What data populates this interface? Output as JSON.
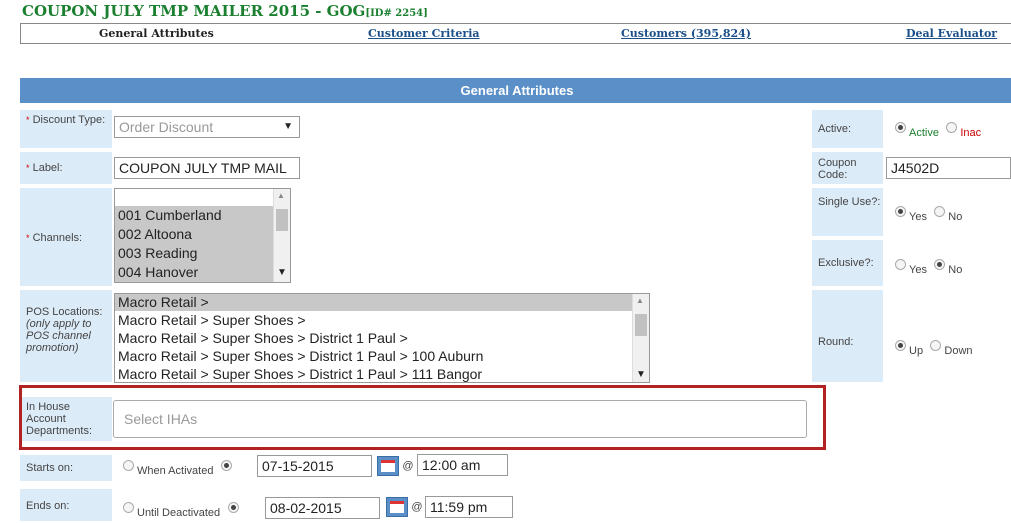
{
  "title": {
    "main": "COUPON JULY TMP MAILER 2015 - GOG",
    "id": "[ID# 2254]"
  },
  "tabs": [
    {
      "label": "General Attributes"
    },
    {
      "label": "Customer Criteria"
    },
    {
      "label": "Customers (395,824)"
    },
    {
      "label": "Deal Evaluator"
    }
  ],
  "panel": {
    "title": "General Attributes"
  },
  "discount_type": {
    "required_mark": "*",
    "label": "Discount Type:",
    "value": "Order Discount"
  },
  "label_field": {
    "required_mark": "*",
    "label": "Label:",
    "value": "COUPON JULY TMP MAIL"
  },
  "channels": {
    "required_mark": "*",
    "label": "Channels:",
    "options": [
      "001 Cumberland",
      "002 Altoona",
      "003 Reading",
      "004 Hanover"
    ]
  },
  "pos_locations": {
    "label": "POS Locations:",
    "note": "(only apply to POS channel promotion)",
    "options": [
      "Macro Retail >",
      "Macro Retail > Super Shoes >",
      "Macro Retail > Super Shoes > District 1 Paul >",
      "Macro Retail > Super Shoes > District 1 Paul > 100 Auburn",
      "Macro Retail > Super Shoes > District 1 Paul > 111 Bangor"
    ]
  },
  "ihas": {
    "label": "In House Account Departments:",
    "placeholder": "Select IHAs"
  },
  "starts_on": {
    "label": "Starts on:",
    "option1": "When Activated",
    "date": "07-15-2015",
    "at": "@",
    "time": "12:00 am"
  },
  "ends_on": {
    "label": "Ends on:",
    "option1": "Until Deactivated",
    "date": "08-02-2015",
    "at": "@",
    "time": "11:59 pm"
  },
  "active": {
    "label": "Active:",
    "opt_on": "Active",
    "opt_off": "Inac"
  },
  "coupon_code": {
    "label": "Coupon Code:",
    "value": "J4502D"
  },
  "single_use": {
    "label": "Single Use?:",
    "yes": "Yes",
    "no": "No"
  },
  "exclusive": {
    "label": "Exclusive?:",
    "yes": "Yes",
    "no": "No"
  },
  "round": {
    "label": "Round:",
    "up": "Up",
    "down": "Down"
  }
}
